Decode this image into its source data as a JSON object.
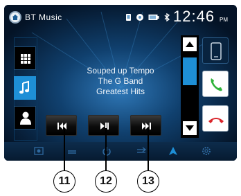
{
  "status_bar": {
    "app_title": "BT Music",
    "time": "12:46",
    "ampm": "PM",
    "icons": [
      "home-icon",
      "phone-signal-icon",
      "settings-dot-icon",
      "battery-icon",
      "bluetooth-icon"
    ]
  },
  "left_menu": {
    "items": [
      {
        "icon": "grid-menu-icon",
        "active": false
      },
      {
        "icon": "music-note-icon",
        "active": true
      },
      {
        "icon": "contact-person-icon",
        "active": false
      }
    ]
  },
  "track": {
    "title": "Souped up Tempo",
    "artist": "The G Band",
    "album": "Greatest Hits"
  },
  "controls": [
    {
      "icon": "previous-track-icon"
    },
    {
      "icon": "play-pause-icon"
    },
    {
      "icon": "next-track-icon"
    }
  ],
  "scroll": {
    "up_icon": "arrow-up-icon",
    "down_icon": "arrow-down-icon"
  },
  "right_buttons": [
    {
      "icon": "phone-device-icon"
    },
    {
      "icon": "call-accept-icon"
    },
    {
      "icon": "call-end-icon"
    }
  ],
  "bottom_bar": {
    "icons": [
      "radio-icon",
      "media-icon",
      "power-icon",
      "eq-icon",
      "navigation-icon",
      "settings-gear-icon"
    ]
  },
  "callouts": [
    "11",
    "12",
    "13"
  ],
  "colors": {
    "screen_bg": "#061c34",
    "accent_blue": "#1e8fd6",
    "accept_green": "#2fb33a",
    "end_red": "#d9242a"
  }
}
